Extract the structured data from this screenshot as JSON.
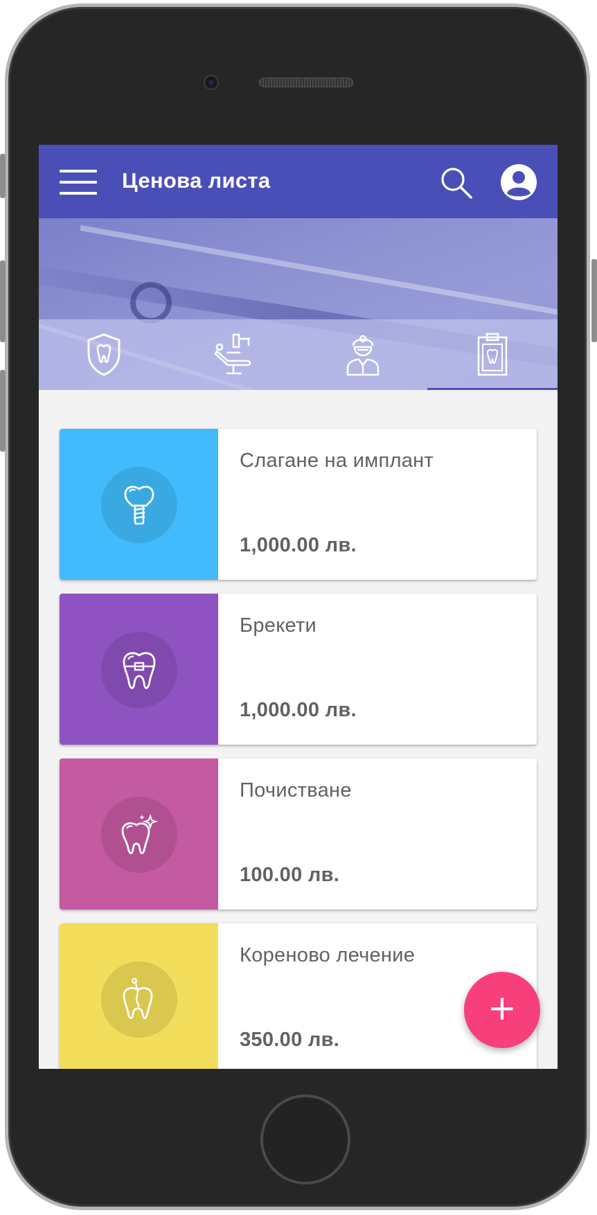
{
  "header": {
    "title": "Ценова листа",
    "menu_icon": "menu-icon",
    "search_icon": "search-icon",
    "account_icon": "account-circle-icon",
    "color": "#4a4fb7"
  },
  "tabs": [
    {
      "icon": "tooth-shield-icon",
      "selected": false
    },
    {
      "icon": "dental-chair-icon",
      "selected": false
    },
    {
      "icon": "dentist-icon",
      "selected": false
    },
    {
      "icon": "dental-clipboard-icon",
      "selected": true
    }
  ],
  "services": [
    {
      "name": "Слагане на имплант",
      "price": "1,000.00 лв.",
      "color": "#41bbfb",
      "icon": "tooth-implant-icon"
    },
    {
      "name": "Брекети",
      "price": "1,000.00 лв.",
      "color": "#8f52c1",
      "icon": "tooth-braces-icon"
    },
    {
      "name": "Почистване",
      "price": "100.00 лв.",
      "color": "#c45aa2",
      "icon": "sparkling-tooth-icon"
    },
    {
      "name": "Кореново лечение",
      "price": "350.00 лв.",
      "color": "#f2de5a",
      "icon": "root-canal-tooth-icon"
    }
  ],
  "fab": {
    "label": "+",
    "icon": "add-icon",
    "color": "#f73f7b"
  }
}
